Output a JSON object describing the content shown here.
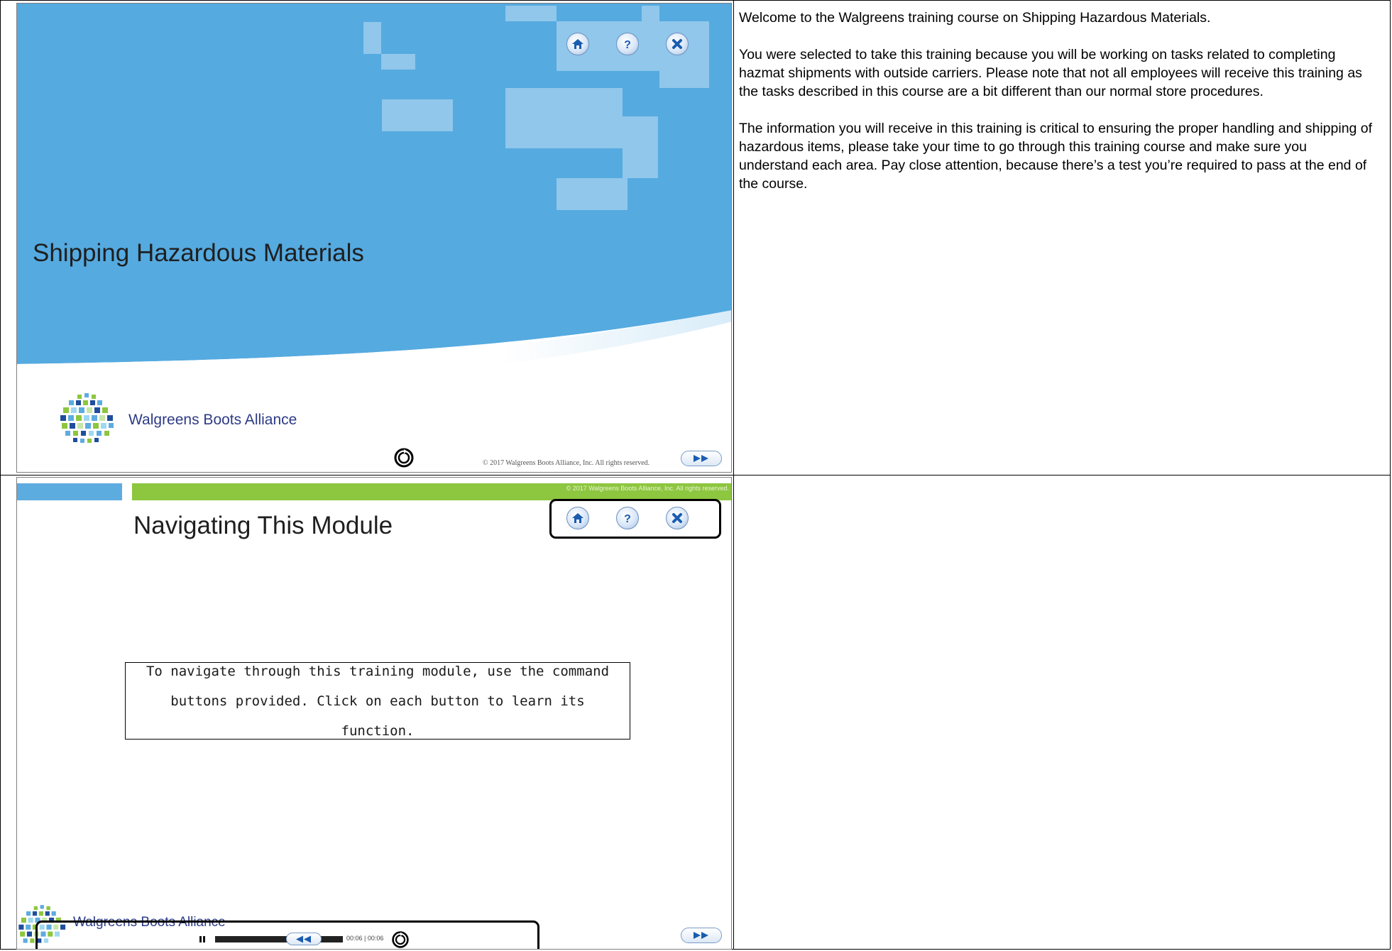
{
  "slide1": {
    "title": "Shipping Hazardous Materials",
    "logo_text": "Walgreens Boots Alliance",
    "copyright": "© 2017 Walgreens Boots Alliance, Inc. All rights reserved.",
    "nav_icons": [
      "home-icon",
      "help-icon",
      "close-icon"
    ],
    "colors": {
      "blue": "#55aae0",
      "logo_text": "#2d3b86"
    }
  },
  "slide2": {
    "title": "Navigating This Module",
    "copyright": "© 2017 Walgreens Boots Alliance, Inc. All rights reserved.",
    "instruction": "To navigate through this training module, use the command buttons provided. Click on each button to learn its function.",
    "logo_text": "Walgreens Boots Alliance",
    "time_label": "00:06 | 00:06",
    "nav_icons": [
      "home-icon",
      "help-icon",
      "close-icon"
    ],
    "colors": {
      "top_bar_green": "#8dc63f",
      "top_bar_blue": "#5dace0"
    }
  },
  "notes": {
    "paragraphs": [
      "Welcome to the Walgreens training course on Shipping Hazardous Materials.",
      "You were selected to take this training because you will be working on tasks related to completing hazmat shipments with outside carriers.  Please note that not all employees will receive this training as the tasks described in this course are a bit different than our normal store procedures.",
      "The information you will receive in this training is critical to ensuring the proper handling and shipping of hazardous items, please take your time to go through this training course and make sure you understand each area.  Pay close attention, because there’s a test you’re required to pass at the end of the course."
    ]
  }
}
